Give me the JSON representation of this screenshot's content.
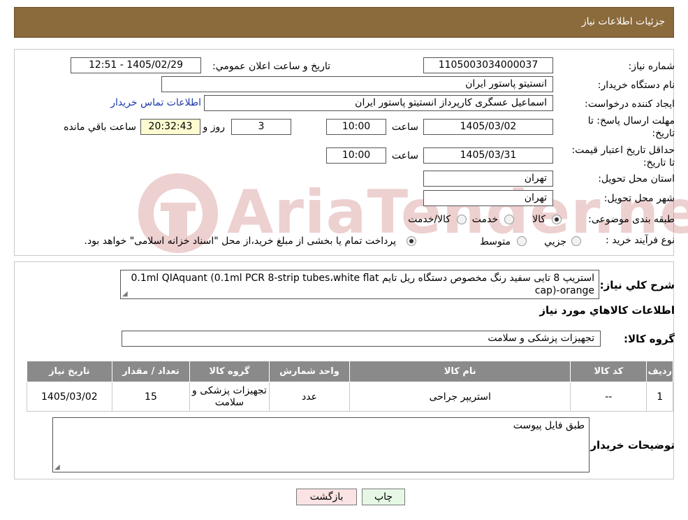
{
  "header": {
    "title": "جزئیات اطلاعات نیاز"
  },
  "form": {
    "need_number_label": "شماره نیاز:",
    "need_number": "1105003034000037",
    "announce_label": "تاريخ و ساعت اعلان عمومي:",
    "announce_value": "1405/02/29 - 12:51",
    "buyer_org_label": "نام دستگاه خريدار:",
    "buyer_org": "انستيتو پاستور ايران",
    "requester_label": "ايجاد کننده درخواست:",
    "requester": "اسماعيل عسگری كارپرداز انستيتو پاستور ايران",
    "contact_link": "اطلاعات تماس خریدار",
    "deadline_label": "مهلت ارسال پاسخ: تا تاریخ:",
    "deadline_date": "1405/03/02",
    "time_label": "ساعت",
    "deadline_time": "10:00",
    "days_value": "3",
    "days_label": "روز و",
    "remaining_time": "20:32:43",
    "remaining_label": "ساعت باقي مانده",
    "validity_label": "حداقل تاريخ اعتبار قيمت: تا تاریخ:",
    "validity_date": "1405/03/31",
    "validity_time": "10:00",
    "province_label": "استان محل تحويل:",
    "province": "تهران",
    "city_label": "شهر محل تحويل:",
    "city": "تهران",
    "category_label": "طبقه بندی موضوعی:",
    "category_options": [
      "کالا",
      "خدمت",
      "کالا/خدمت"
    ],
    "process_label": "نوع فرآيند خريد :",
    "process_options": [
      "جزيي",
      "متوسط"
    ],
    "process_note": "پرداخت تمام یا بخشی از مبلغ خرید،از محل \"اسناد خزانه اسلامی\" خواهد بود."
  },
  "details": {
    "general_desc_label": "شرح کلي نياز:",
    "general_desc": "استریپ 8 تایی سفید رنگ مخصوص دستگاه ریل تایم 0.1ml QIAquant (0.1ml PCR 8-strip tubes،white flat cap)-orange",
    "goods_info_title": "اطلاعات کالاهاي مورد نياز",
    "goods_group_label": "گروه کالا:",
    "goods_group": "تجهیزات پزشکی و سلامت",
    "table": {
      "headers": [
        "رديف",
        "کد کالا",
        "نام کالا",
        "واحد شمارش",
        "گروه کالا",
        "تعداد / مقدار",
        "تاريخ نياز"
      ],
      "rows": [
        [
          "1",
          "--",
          "استریپر جراحی",
          "عدد",
          "تجهیزات پزشکی و سلامت",
          "15",
          "1405/03/02"
        ]
      ]
    },
    "buyer_notes_label": "توضيحات خريدار:",
    "buyer_notes": "طبق فایل پیوست"
  },
  "buttons": {
    "print": "چاپ",
    "back": "بازگشت"
  },
  "watermark": {
    "text": "AriaTender.neT"
  },
  "colors": {
    "header_bg": "#8b6a3c",
    "table_header_bg": "#8a8a8a",
    "print_bg": "#e6f7e6",
    "back_bg": "#fbe3e3",
    "link": "#1a3aa8",
    "watermark": "#b12f2f"
  }
}
